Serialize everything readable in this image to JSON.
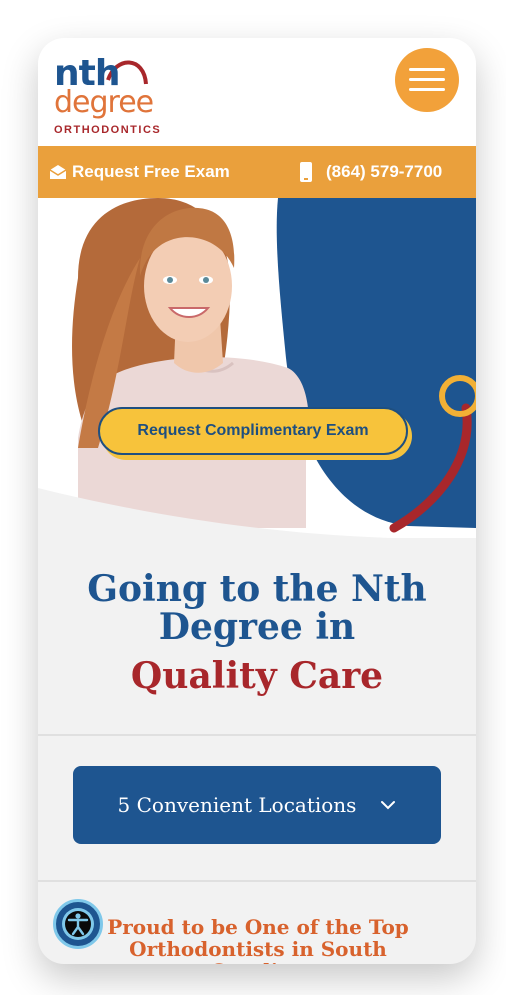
{
  "brand": {
    "logo_nth": "nth",
    "logo_degree": "degree",
    "logo_orthodontics": "ORTHODONTICS"
  },
  "topbar": {
    "exam_label": "Request Free Exam",
    "phone_label": "(864) 579-7700"
  },
  "hero": {
    "cta_label": "Request Complimentary Exam"
  },
  "headline": {
    "line1": "Going to the Nth",
    "line2": "Degree in",
    "line3": "Quality Care"
  },
  "locations": {
    "label": "5 Convenient Locations"
  },
  "proud": {
    "line1": "Proud to be One of the Top",
    "line2": "Orthodontists in South Carolina"
  },
  "colors": {
    "brand_blue": "#1e5590",
    "brand_orange": "#eaa03c",
    "brand_red": "#a8272b",
    "cta_yellow": "#f7c33b"
  }
}
